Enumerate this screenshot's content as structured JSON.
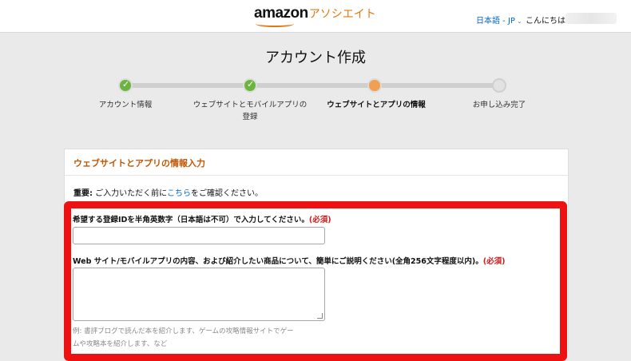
{
  "header": {
    "logo_brand": "amazon",
    "logo_suffix": "アソシエイト",
    "language": "日本語 - JP",
    "greeting": "こんにちは"
  },
  "page_title": "アカウント作成",
  "steps": [
    {
      "label": "アカウント情報",
      "status": "done"
    },
    {
      "label": "ウェブサイトとモバイルアプリの",
      "label2": "登録",
      "status": "done"
    },
    {
      "label": "ウェブサイトとアプリの情報",
      "status": "current"
    },
    {
      "label": "お申し込み完了",
      "status": "todo"
    }
  ],
  "section": {
    "title": "ウェブサイトとアプリの情報入力",
    "notice_bold": "重要:",
    "notice_pre": " ご入力いただく前に",
    "notice_link": "こちら",
    "notice_post": "をご確認ください。"
  },
  "form": {
    "field1_label": "希望する登録IDを半角英数字（日本語は不可）で入力してください。",
    "field1_required": "(必須)",
    "field1_value": "",
    "field2_label": "Web サイト/モバイルアプリの内容、および紹介したい商品について、簡単にご説明ください(全角256文字程度以内)。",
    "field2_required": "(必須)",
    "field2_value": "",
    "hint_line1": "例: 書評ブログで読んだ本を紹介します、ゲームの攻略情報サイトでゲー",
    "hint_line2": "ムや攻略本を紹介します、など"
  },
  "colors": {
    "brand_orange": "#e47911",
    "section_title": "#c45500",
    "link_blue": "#0066c0",
    "required_red": "#cc1b1b",
    "highlight_red": "#ee1111",
    "step_done": "#6db33f",
    "step_current": "#f0a050"
  }
}
